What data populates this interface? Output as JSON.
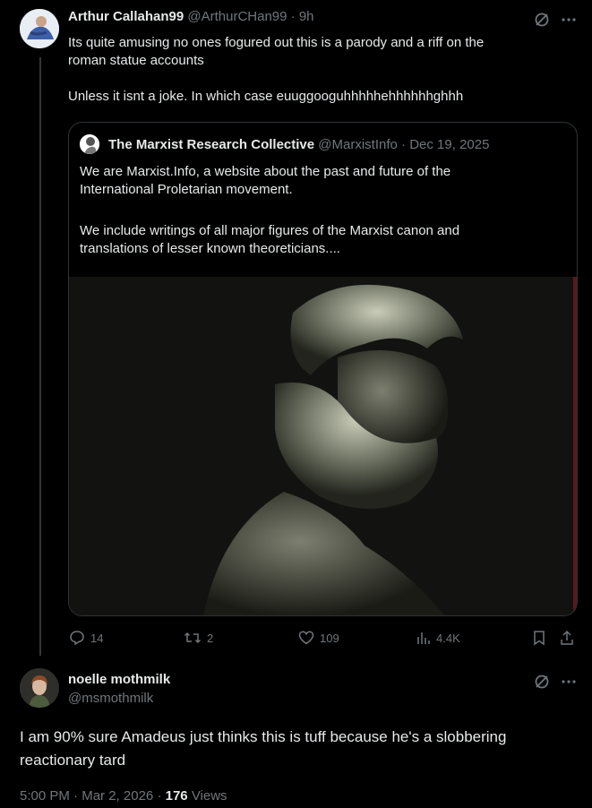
{
  "post1": {
    "display_name": "Arthur Callahan99",
    "handle": "@ArthurCHan99",
    "separator": "·",
    "time": "9h",
    "line1": "Its quite amusing no ones fogured out this is a parody and a riff on the",
    "line2": "roman statue accounts",
    "line3": "Unless it isnt a joke. In which case euuggooguhhhhhehhhhhhghhh",
    "avatar_icon": "user-avatar-icon",
    "grok_icon": "grok-icon",
    "more_icon": "more-icon"
  },
  "quote": {
    "display_name": "The Marxist Research Collective",
    "handle": "@MarxistInfo",
    "separator": "·",
    "date": "Dec 19, 2025",
    "p1_line1": "We are Marxist.Info, a website about the past and future of the",
    "p1_line2": "International Proletarian movement.",
    "p2_line1": "We include writings of all major figures of the Marxist canon and",
    "p2_line2": "translations of lesser known theoreticians....",
    "media_icon": "statue-image"
  },
  "actions": {
    "replies": "14",
    "reposts": "2",
    "likes": "109",
    "views": "4.4K"
  },
  "post2": {
    "display_name": "noelle mothmilk",
    "handle": "@msmothmilk",
    "text_line1": "I am 90% sure Amadeus just thinks this is tuff because he's a slobbering",
    "text_line2": "reactionary tard",
    "time": "5:00 PM",
    "separator": "·",
    "date": "Mar 2, 2026",
    "separator2": "·",
    "views_count": "176",
    "views_label": "Views"
  },
  "colors": {
    "background": "#000000",
    "text": "#e7e9ea",
    "muted": "#71767b",
    "border": "#2f3336"
  }
}
